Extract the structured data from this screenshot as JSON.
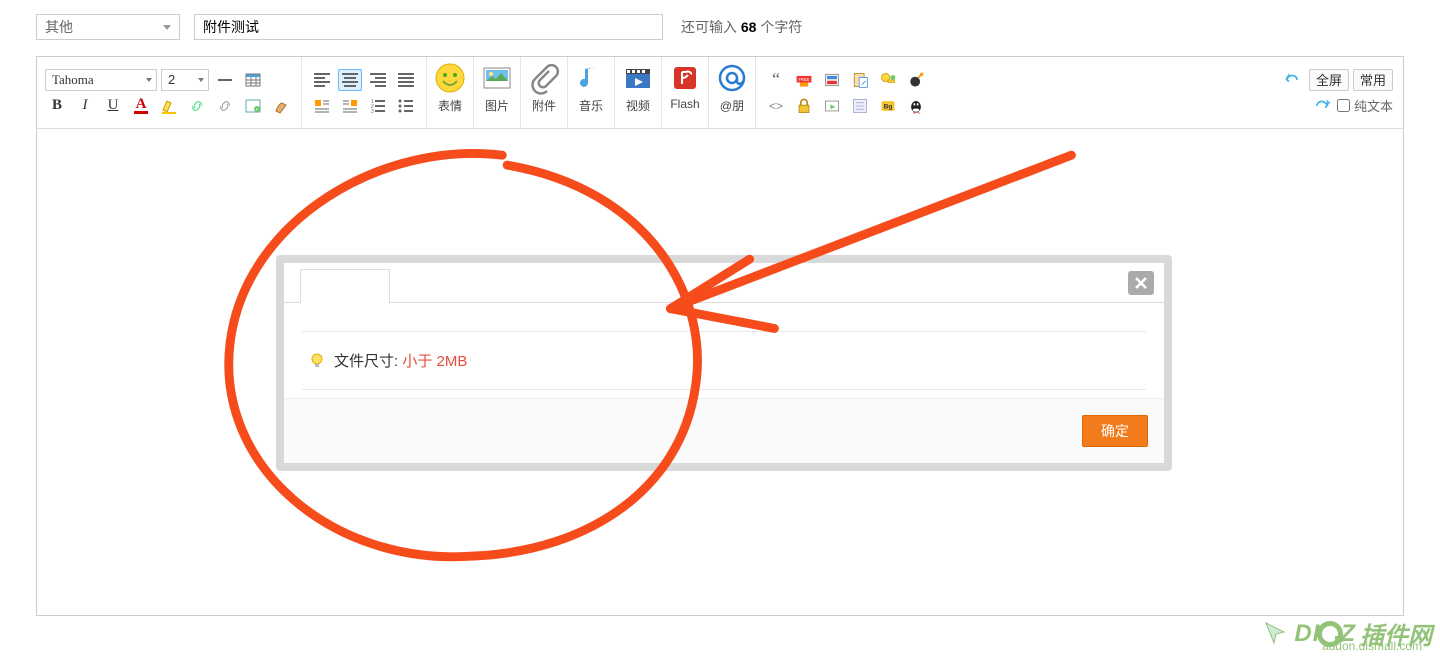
{
  "header": {
    "category_value": "其他",
    "title_value": "附件测试",
    "char_prefix": "还可输入 ",
    "char_count": "68",
    "char_suffix": " 个字符"
  },
  "toolbar": {
    "font_value": "Tahoma",
    "size_value": "2",
    "big_items": {
      "smiley": "表情",
      "image": "图片",
      "attach": "附件",
      "music": "音乐",
      "video": "视频",
      "flash": "Flash",
      "at": "@朋"
    },
    "free_label": "FREE",
    "bg_label": "Bg",
    "fullscreen_btn": "全屏",
    "common_btn": "常用",
    "plain_text_label": "纯文本"
  },
  "dialog": {
    "hint_prefix": "文件尺寸: ",
    "hint_red": "小于 2MB",
    "ok_button": "确定"
  },
  "watermark": {
    "text1_a": "D",
    "text1_b": "Z",
    "text2": "插件网",
    "sub": "addon.dismall.com"
  }
}
